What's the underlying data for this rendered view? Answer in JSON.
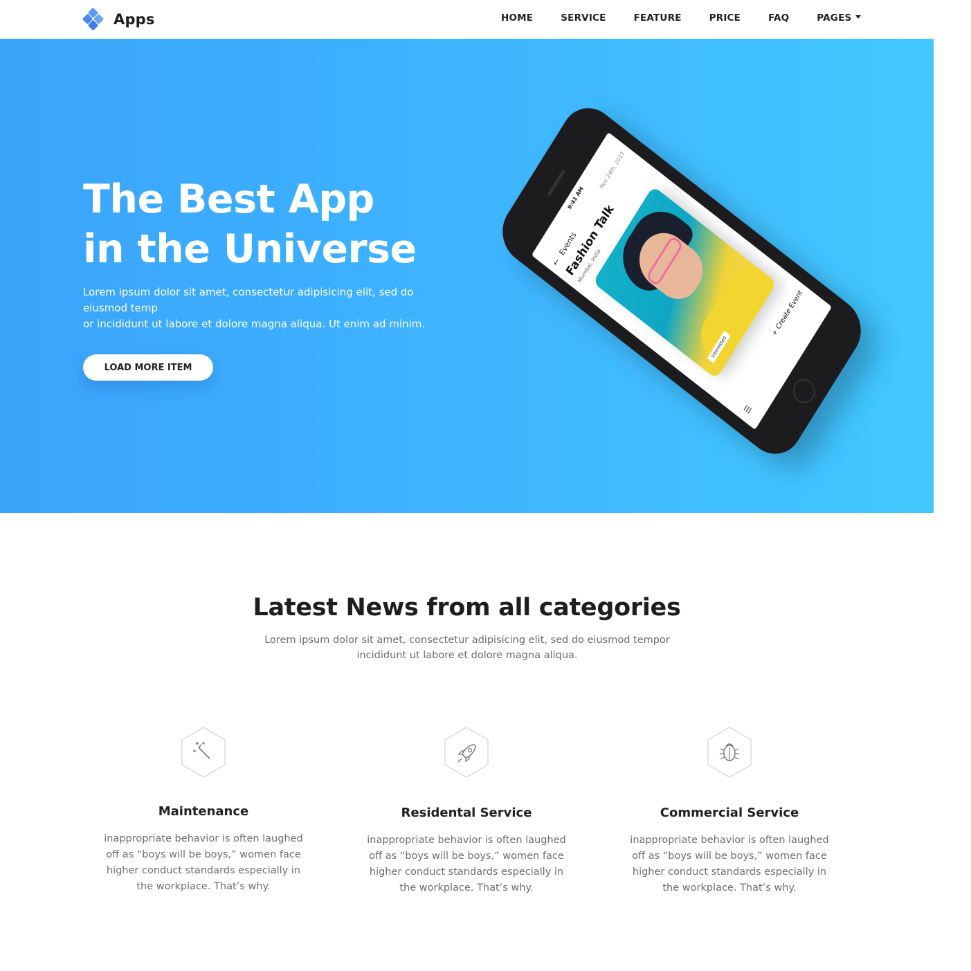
{
  "brand": {
    "name": "Apps",
    "icon": "diamond-cluster-logo",
    "accent": "#4f8ff0"
  },
  "nav": {
    "items": [
      "HOME",
      "SERVICE",
      "FEATURE",
      "PRICE",
      "FAQ"
    ],
    "pages_label": "PAGES"
  },
  "hero": {
    "title_line1": "The Best App",
    "title_line2": "in the Universe",
    "desc_line1": "Lorem ipsum dolor sit amet, consectetur adipisicing elit, sed do eiusmod temp",
    "desc_line2": "or incididunt ut labore et dolore magna aliqua. Ut enim ad minim.",
    "button_label": "LOAD MORE ITEM",
    "gradient_start": "#3aa4fb",
    "gradient_end": "#42c8ff"
  },
  "phone": {
    "status_time": "9:41 AM",
    "back_label": "←",
    "section": "Events",
    "date": "Nov 24th, 2017",
    "event_title": "Fashion Talk",
    "location": "Mumbai, India",
    "tag": "Interested",
    "create": "+ Create Event",
    "menu_icon": "☰"
  },
  "news": {
    "title": "Latest News from all categories",
    "desc": "Lorem ipsum dolor sit amet, consectetur adipisicing elit, sed do eiusmod tempor incididunt ut labore et dolore magna aliqua.",
    "features": [
      {
        "icon": "magic-wand-icon",
        "title": "Maintenance",
        "desc": "inappropriate behavior is often laughed off as “boys will be boys,” women face higher conduct standards especially in the workplace. That’s why."
      },
      {
        "icon": "rocket-icon",
        "title": "Residental Service",
        "desc": "inappropriate behavior is often laughed off as “boys will be boys,” women face higher conduct standards especially in the workplace. That’s why."
      },
      {
        "icon": "bug-icon",
        "title": "Commercial Service",
        "desc": "inappropriate behavior is often laughed off as “boys will be boys,” women face higher conduct standards especially in the workplace. That’s why."
      }
    ]
  }
}
